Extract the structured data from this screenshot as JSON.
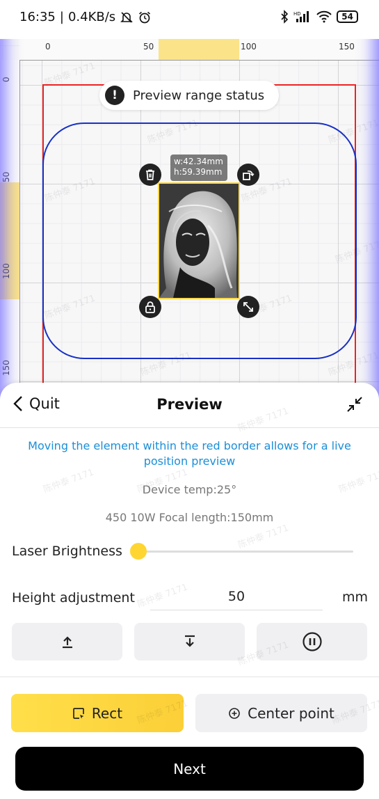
{
  "status_bar": {
    "time": "16:35",
    "speed": "0.4KB/s",
    "battery": "54",
    "icons": [
      "mute-icon",
      "alarm-icon",
      "bluetooth-icon",
      "signal-icon",
      "wifi-icon",
      "battery-icon"
    ]
  },
  "ruler": {
    "top_ticks": [
      "0",
      "50",
      "100",
      "150"
    ],
    "left_ticks": [
      "0",
      "50",
      "100",
      "150"
    ]
  },
  "canvas": {
    "preview_status": "Preview range status",
    "width_label": "w:42.34mm",
    "height_label": "h:59.39mm",
    "watermark": "陈仲泰 7171",
    "icons": [
      "delete-icon",
      "rotate-icon",
      "lock-icon",
      "resize-icon"
    ],
    "colors": {
      "work_border": "#e22222",
      "preview_range": "#1730c8",
      "selection": "#ffd84a"
    }
  },
  "panel": {
    "quit": "Quit",
    "title": "Preview",
    "hint": "Moving the element within the red border allows for a live position preview",
    "device_temp": "Device temp:25°",
    "laser_info": "450 10W Focal length:150mm",
    "brightness_label": "Laser Brightness",
    "brightness_value": 0,
    "height_label": "Height adjustment",
    "height_value": "50",
    "height_unit": "mm",
    "controls": [
      "move-up-icon",
      "move-down-icon",
      "pause-icon"
    ],
    "modes": {
      "rect": "Rect",
      "center": "Center point",
      "active": "rect"
    },
    "next": "Next",
    "colors": {
      "accent": "#ffd631",
      "hint": "#1a8fd8",
      "next_bg": "#000000"
    }
  }
}
